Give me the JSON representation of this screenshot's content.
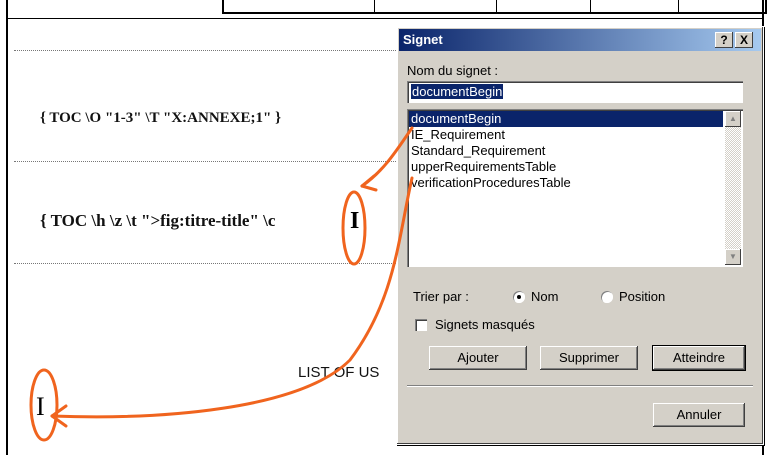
{
  "document": {
    "field_code_1": "{ TOC \\O \"1-3\" \\T \"X:ANNEXE;1\" }",
    "field_code_2": "{ TOC \\h \\z \\t \">fig:titre-title\" \\c",
    "list_text": "LIST OF US",
    "cursor_glyph": "I"
  },
  "dialog": {
    "title": "Signet",
    "help_label": "?",
    "close_label": "X",
    "name_label": "Nom du signet :",
    "name_value": "documentBegin",
    "bookmarks": [
      "documentBegin",
      "IE_Requirement",
      "Standard_Requirement",
      "upperRequirementsTable",
      "verificationProceduresTable"
    ],
    "selected_index": 0,
    "sort_label": "Trier par :",
    "sort_options": {
      "name": "Nom",
      "position": "Position"
    },
    "sort_selected": "name",
    "hidden_label": "Signets masqués",
    "buttons": {
      "add": "Ajouter",
      "delete": "Supprimer",
      "goto": "Atteindre",
      "cancel": "Annuler"
    }
  },
  "annotation_color": "#f0641e",
  "icons": {
    "scroll_up": "scroll-up-icon",
    "scroll_down": "scroll-down-icon"
  }
}
